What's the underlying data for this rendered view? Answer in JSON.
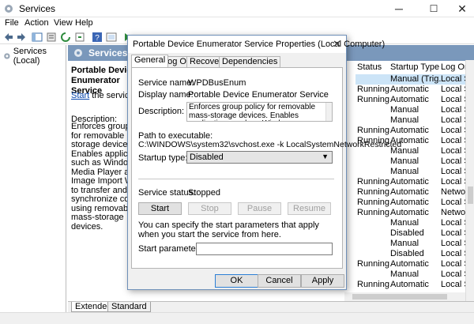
{
  "window": {
    "title": "Services",
    "controls": {
      "minimize": "─",
      "maximize": "☐",
      "close": "✕"
    }
  },
  "menu": [
    "File",
    "Action",
    "View",
    "Help"
  ],
  "tree": {
    "root_label": "Services (Local)"
  },
  "pane": {
    "header": "Services (Local)",
    "service_name": "Portable Device Enumerator Service",
    "start_link": "Start",
    "start_suffix": " the service",
    "description_label": "Description:",
    "description_text": "Enforces group policy for removable mass-storage devices. Enables applications such as Windows Media Player and Image Import Wizard to transfer and synchronize content using removable mass-storage devices."
  },
  "list": {
    "columns": [
      "Status",
      "Startup Type",
      "Log On"
    ],
    "rows": [
      {
        "status": "",
        "startup": "Manual (Trig...",
        "logon": "Local Sy",
        "selected": true
      },
      {
        "status": "Running",
        "startup": "Automatic",
        "logon": "Local Sy"
      },
      {
        "status": "Running",
        "startup": "Automatic",
        "logon": "Local Sy"
      },
      {
        "status": "",
        "startup": "Manual",
        "logon": "Local Sy"
      },
      {
        "status": "",
        "startup": "Manual",
        "logon": "Local Sy"
      },
      {
        "status": "Running",
        "startup": "Automatic",
        "logon": "Local Sy"
      },
      {
        "status": "Running",
        "startup": "Automatic",
        "logon": "Local Sy"
      },
      {
        "status": "",
        "startup": "Manual",
        "logon": "Local Sy"
      },
      {
        "status": "",
        "startup": "Manual",
        "logon": "Local Sy"
      },
      {
        "status": "",
        "startup": "Manual",
        "logon": "Local Sy"
      },
      {
        "status": "Running",
        "startup": "Automatic",
        "logon": "Local Sy"
      },
      {
        "status": "Running",
        "startup": "Automatic",
        "logon": "Networ"
      },
      {
        "status": "Running",
        "startup": "Automatic",
        "logon": "Local Sy"
      },
      {
        "status": "Running",
        "startup": "Automatic",
        "logon": "Networ"
      },
      {
        "status": "",
        "startup": "Manual",
        "logon": "Local Sy"
      },
      {
        "status": "",
        "startup": "Disabled",
        "logon": "Local Sy"
      },
      {
        "status": "",
        "startup": "Manual",
        "logon": "Local Sy"
      },
      {
        "status": "",
        "startup": "Disabled",
        "logon": "Local Sy"
      },
      {
        "status": "Running",
        "startup": "Automatic",
        "logon": "Local Sy"
      },
      {
        "status": "",
        "startup": "Manual",
        "logon": "Local Sy"
      },
      {
        "status": "Running",
        "startup": "Automatic",
        "logon": "Local Sy"
      }
    ]
  },
  "view_tabs": [
    "Extended",
    "Standard"
  ],
  "dialog": {
    "title": "Portable Device Enumerator Service Properties (Local Computer)",
    "close": "✕",
    "tabs": [
      "General",
      "Log On",
      "Recovery",
      "Dependencies"
    ],
    "service_name_label": "Service name:",
    "service_name": "WPDBusEnum",
    "display_name_label": "Display name:",
    "display_name": "Portable Device Enumerator Service",
    "description_label": "Description:",
    "description": "Enforces group policy for removable mass-storage devices. Enables applications such as Windows",
    "path_label": "Path to executable:",
    "path": "C:\\WINDOWS\\system32\\svchost.exe -k LocalSystemNetworkRestricted",
    "startup_type_label": "Startup type:",
    "startup_type": "Disabled",
    "status_label": "Service status:",
    "status": "Stopped",
    "buttons": {
      "start": "Start",
      "stop": "Stop",
      "pause": "Pause",
      "resume": "Resume"
    },
    "hint": "You can specify the start parameters that apply when you start the service from here.",
    "params_label": "Start parameters:",
    "params_value": "",
    "footer": {
      "ok": "OK",
      "cancel": "Cancel",
      "apply": "Apply"
    }
  }
}
